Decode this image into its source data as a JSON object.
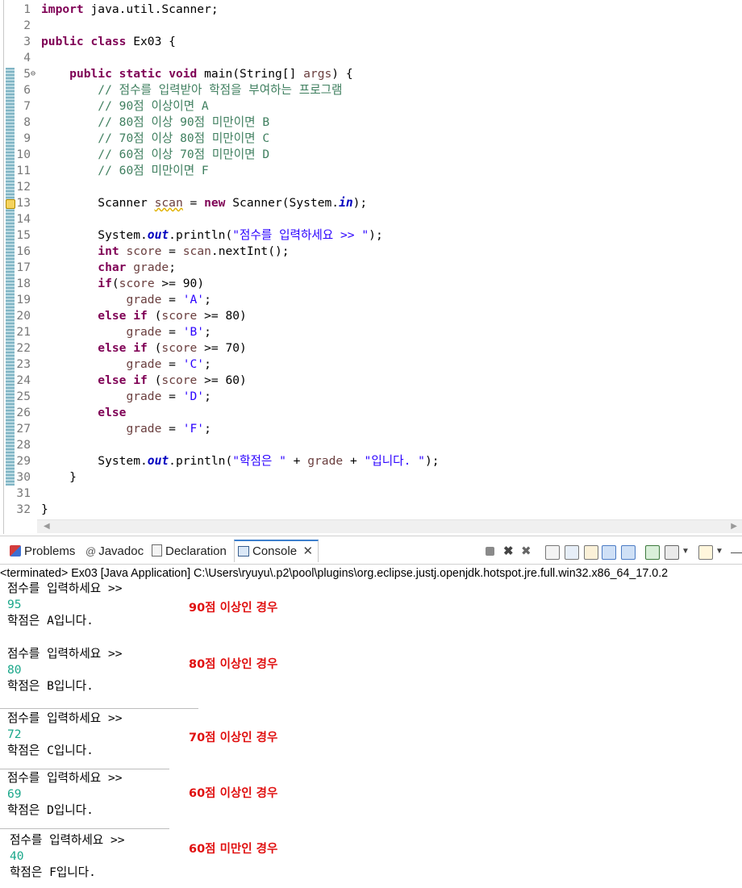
{
  "editor": {
    "lines": [
      {
        "n": "1",
        "tokens": [
          {
            "t": "import",
            "c": "kw"
          },
          {
            "t": " java.util.Scanner;"
          }
        ]
      },
      {
        "n": "2",
        "tokens": []
      },
      {
        "n": "3",
        "tokens": [
          {
            "t": "public",
            "c": "kw"
          },
          {
            "t": " "
          },
          {
            "t": "class",
            "c": "kw"
          },
          {
            "t": " Ex03 {"
          }
        ]
      },
      {
        "n": "4",
        "tokens": []
      },
      {
        "n": "5",
        "fold": true,
        "tokens": [
          {
            "t": "    "
          },
          {
            "t": "public",
            "c": "kw"
          },
          {
            "t": " "
          },
          {
            "t": "static",
            "c": "kw"
          },
          {
            "t": " "
          },
          {
            "t": "void",
            "c": "kw"
          },
          {
            "t": " main(String[] "
          },
          {
            "t": "args",
            "c": "var"
          },
          {
            "t": ") {"
          }
        ]
      },
      {
        "n": "6",
        "tokens": [
          {
            "t": "        "
          },
          {
            "t": "// 점수를 입력받아 학점을 부여하는 프로그램",
            "c": "cm"
          }
        ]
      },
      {
        "n": "7",
        "tokens": [
          {
            "t": "        "
          },
          {
            "t": "// 90점 이상이면 A",
            "c": "cm"
          }
        ]
      },
      {
        "n": "8",
        "tokens": [
          {
            "t": "        "
          },
          {
            "t": "// 80점 이상 90점 미만이면 B",
            "c": "cm"
          }
        ]
      },
      {
        "n": "9",
        "tokens": [
          {
            "t": "        "
          },
          {
            "t": "// 70점 이상 80점 미만이면 C",
            "c": "cm"
          }
        ]
      },
      {
        "n": "10",
        "tokens": [
          {
            "t": "        "
          },
          {
            "t": "// 60점 이상 70점 미만이면 D",
            "c": "cm"
          }
        ]
      },
      {
        "n": "11",
        "tokens": [
          {
            "t": "        "
          },
          {
            "t": "// 60점 미만이면 F",
            "c": "cm"
          }
        ]
      },
      {
        "n": "12",
        "tokens": []
      },
      {
        "n": "13",
        "warn": true,
        "tokens": [
          {
            "t": "        Scanner "
          },
          {
            "t": "scan",
            "c": "var warn-underline"
          },
          {
            "t": " = "
          },
          {
            "t": "new",
            "c": "kw"
          },
          {
            "t": " Scanner(System."
          },
          {
            "t": "in",
            "c": "fld"
          },
          {
            "t": ");"
          }
        ]
      },
      {
        "n": "14",
        "tokens": []
      },
      {
        "n": "15",
        "tokens": [
          {
            "t": "        System."
          },
          {
            "t": "out",
            "c": "fld"
          },
          {
            "t": ".println("
          },
          {
            "t": "\"점수를 입력하세요 >> \"",
            "c": "st"
          },
          {
            "t": ");"
          }
        ]
      },
      {
        "n": "16",
        "tokens": [
          {
            "t": "        "
          },
          {
            "t": "int",
            "c": "kw"
          },
          {
            "t": " "
          },
          {
            "t": "score",
            "c": "var"
          },
          {
            "t": " = "
          },
          {
            "t": "scan",
            "c": "var"
          },
          {
            "t": ".nextInt();"
          }
        ]
      },
      {
        "n": "17",
        "tokens": [
          {
            "t": "        "
          },
          {
            "t": "char",
            "c": "kw"
          },
          {
            "t": " "
          },
          {
            "t": "grade",
            "c": "var"
          },
          {
            "t": ";"
          }
        ]
      },
      {
        "n": "18",
        "tokens": [
          {
            "t": "        "
          },
          {
            "t": "if",
            "c": "kw"
          },
          {
            "t": "("
          },
          {
            "t": "score",
            "c": "var"
          },
          {
            "t": " >= 90)"
          }
        ]
      },
      {
        "n": "19",
        "tokens": [
          {
            "t": "            "
          },
          {
            "t": "grade",
            "c": "var"
          },
          {
            "t": " = "
          },
          {
            "t": "'A'",
            "c": "st"
          },
          {
            "t": ";"
          }
        ]
      },
      {
        "n": "20",
        "tokens": [
          {
            "t": "        "
          },
          {
            "t": "else",
            "c": "kw"
          },
          {
            "t": " "
          },
          {
            "t": "if",
            "c": "kw"
          },
          {
            "t": " ("
          },
          {
            "t": "score",
            "c": "var"
          },
          {
            "t": " >= 80)"
          }
        ]
      },
      {
        "n": "21",
        "tokens": [
          {
            "t": "            "
          },
          {
            "t": "grade",
            "c": "var"
          },
          {
            "t": " = "
          },
          {
            "t": "'B'",
            "c": "st"
          },
          {
            "t": ";"
          }
        ]
      },
      {
        "n": "22",
        "tokens": [
          {
            "t": "        "
          },
          {
            "t": "else",
            "c": "kw"
          },
          {
            "t": " "
          },
          {
            "t": "if",
            "c": "kw"
          },
          {
            "t": " ("
          },
          {
            "t": "score",
            "c": "var"
          },
          {
            "t": " >= 70)"
          }
        ]
      },
      {
        "n": "23",
        "tokens": [
          {
            "t": "            "
          },
          {
            "t": "grade",
            "c": "var"
          },
          {
            "t": " = "
          },
          {
            "t": "'C'",
            "c": "st"
          },
          {
            "t": ";"
          }
        ]
      },
      {
        "n": "24",
        "tokens": [
          {
            "t": "        "
          },
          {
            "t": "else",
            "c": "kw"
          },
          {
            "t": " "
          },
          {
            "t": "if",
            "c": "kw"
          },
          {
            "t": " ("
          },
          {
            "t": "score",
            "c": "var"
          },
          {
            "t": " >= 60)"
          }
        ]
      },
      {
        "n": "25",
        "tokens": [
          {
            "t": "            "
          },
          {
            "t": "grade",
            "c": "var"
          },
          {
            "t": " = "
          },
          {
            "t": "'D'",
            "c": "st"
          },
          {
            "t": ";"
          }
        ]
      },
      {
        "n": "26",
        "tokens": [
          {
            "t": "        "
          },
          {
            "t": "else",
            "c": "kw"
          }
        ]
      },
      {
        "n": "27",
        "tokens": [
          {
            "t": "            "
          },
          {
            "t": "grade",
            "c": "var"
          },
          {
            "t": " = "
          },
          {
            "t": "'F'",
            "c": "st"
          },
          {
            "t": ";"
          }
        ]
      },
      {
        "n": "28",
        "tokens": []
      },
      {
        "n": "29",
        "tokens": [
          {
            "t": "        System."
          },
          {
            "t": "out",
            "c": "fld"
          },
          {
            "t": ".println("
          },
          {
            "t": "\"학점은 \"",
            "c": "st"
          },
          {
            "t": " + "
          },
          {
            "t": "grade",
            "c": "var"
          },
          {
            "t": " + "
          },
          {
            "t": "\"입니다. \"",
            "c": "st"
          },
          {
            "t": ");"
          }
        ]
      },
      {
        "n": "30",
        "tokens": [
          {
            "t": "    }"
          }
        ]
      },
      {
        "n": "31",
        "tokens": []
      },
      {
        "n": "32",
        "tokens": [
          {
            "t": "}"
          }
        ]
      }
    ]
  },
  "tabs": [
    {
      "label": "Problems",
      "icon": "problems-icon"
    },
    {
      "label": "Javadoc",
      "icon": "javadoc-icon"
    },
    {
      "label": "Declaration",
      "icon": "declaration-icon"
    },
    {
      "label": "Console",
      "icon": "console-icon",
      "active": true
    }
  ],
  "console": {
    "header": "<terminated> Ex03 [Java Application] C:\\Users\\ryuyu\\.p2\\pool\\plugins\\org.eclipse.justj.openjdk.hotspot.jre.full.win32.x86_64_17.0.2",
    "runs": [
      {
        "prompt": "점수를 입력하세요 >>",
        "input": "95",
        "result": "학점은 A입니다.",
        "note": "90점 이상인 경우"
      },
      {
        "prompt": "점수를 입력하세요 >>",
        "input": "80",
        "result": "학점은 B입니다.",
        "note": "80점 이상인 경우"
      },
      {
        "prompt": "점수를 입력하세요 >>",
        "input": "72",
        "result": "학점은 C입니다.",
        "note": "70점 이상인 경우"
      },
      {
        "prompt": "점수를 입력하세요 >>",
        "input": "69",
        "result": "학점은 D입니다.",
        "note": "60점 이상인 경우"
      },
      {
        "prompt": "점수를 입력하세요 >>",
        "input": "40",
        "result": "학점은 F입니다.",
        "note": "60점 미만인 경우"
      }
    ]
  },
  "colors": {
    "keyword": "#7f0055",
    "comment": "#3f7f5f",
    "string": "#2a00ff",
    "input": "#1aa78a",
    "note": "#e01010"
  }
}
